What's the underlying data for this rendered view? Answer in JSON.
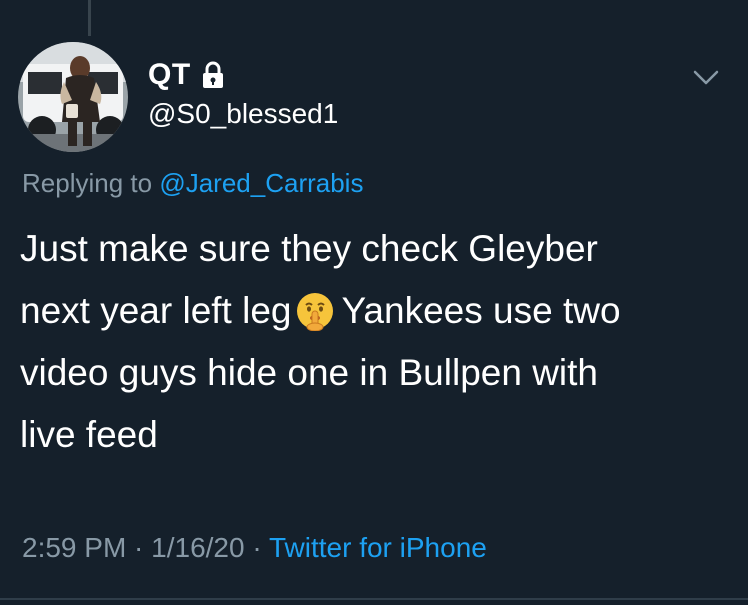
{
  "tweet": {
    "display_name": "QT",
    "handle": "@S0_blessed1",
    "replying_prefix": "Replying to",
    "replying_to": "@Jared_Carrabis",
    "body_lines": [
      "Just make sure they check Gleyber",
      "next year left leg",
      "Yankees use two",
      "video guys hide one in Bullpen with",
      "live feed"
    ],
    "emoji_icon": "shushing-face-emoji",
    "timestamp": "2:59 PM · 1/16/20 · ",
    "source": "Twitter for iPhone"
  },
  "colors": {
    "background": "#15202b",
    "text_primary": "#ffffff",
    "text_secondary": "#8899a6",
    "link": "#1da1f2"
  },
  "icons": {
    "lock": "lock-icon",
    "menu": "chevron-down-icon",
    "avatar": "profile-avatar"
  }
}
